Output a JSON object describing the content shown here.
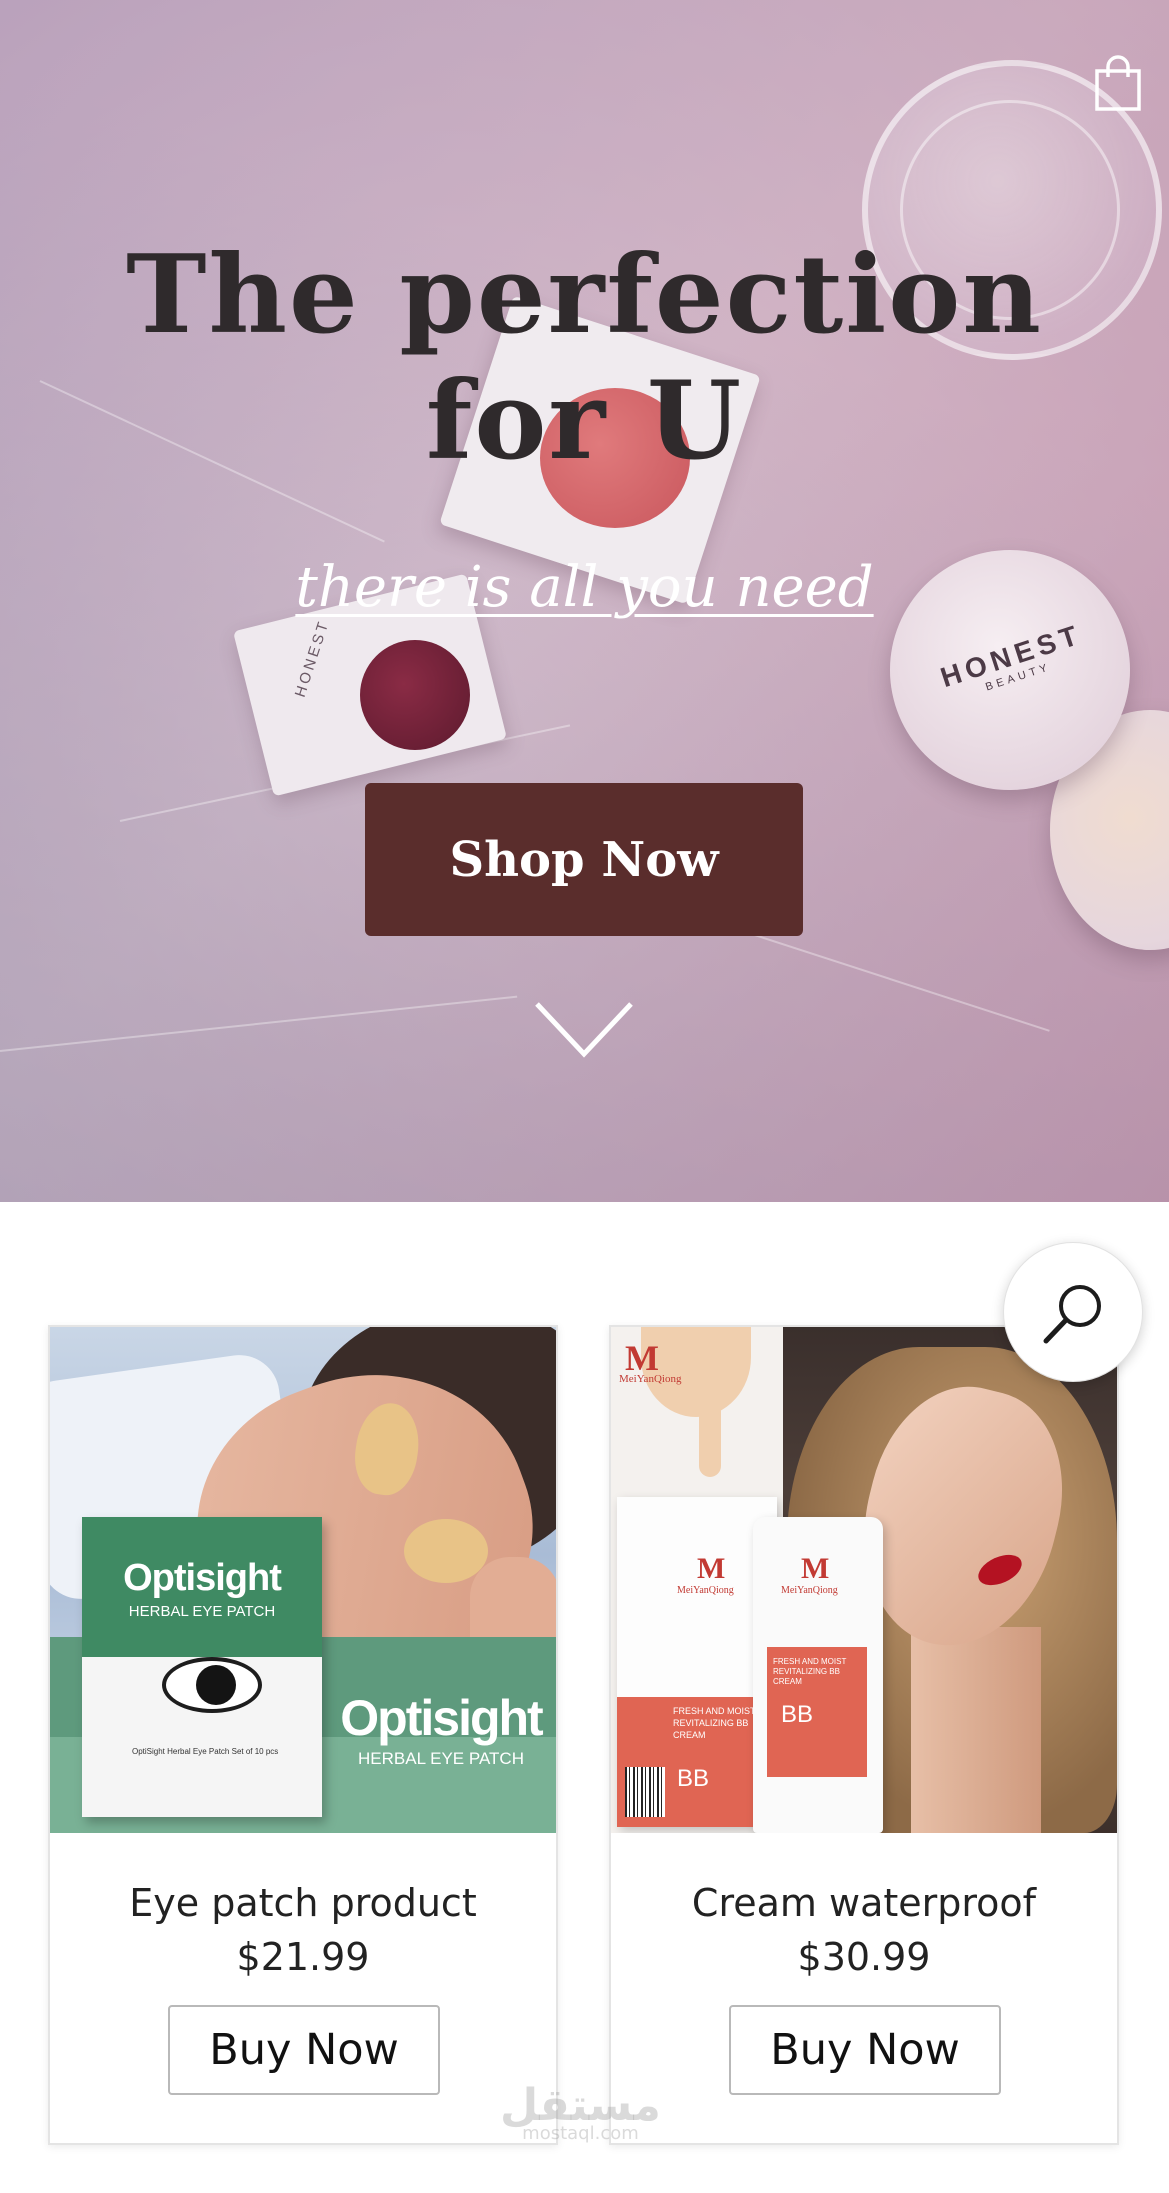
{
  "hero": {
    "title_line1": "The perfection",
    "title_line2": "for U",
    "subtitle": "there is all  you need",
    "cta_label": "Shop Now",
    "cart_icon": "shopping-bag-icon",
    "scroll_icon": "chevron-down-icon",
    "product_branding": {
      "jar_brand": "HONEST",
      "jar_sub": "BEAUTY",
      "compact_brand": "HONEST"
    }
  },
  "search": {
    "icon": "search-icon"
  },
  "products": [
    {
      "name": "Eye patch product",
      "price": "$21.99",
      "button": "Buy Now",
      "image_text": {
        "box_title": "Optisight",
        "box_subtitle": "HERBAL EYE PATCH",
        "box_small": "OptiSight Herbal Eye Patch Set of 10 pcs",
        "big_title": "Optisight",
        "big_subtitle": "HERBAL EYE PATCH"
      }
    },
    {
      "name": "Cream waterproof",
      "price": "$30.99",
      "button": "Buy Now",
      "image_text": {
        "brand": "MeiYanQiong",
        "logo": "M",
        "box_text": "FRESH AND MOIST REVITALIZING BB CREAM",
        "box_bb": "BB",
        "tube_text": "FRESH AND MOIST REVITALIZING BB CREAM",
        "tube_bb": "BB"
      }
    }
  ],
  "watermark": {
    "arabic": "مستقل",
    "latin": "mostaql.com"
  },
  "colors": {
    "cta_bg": "#5a2d2c",
    "text_dark": "#2f2a2c",
    "card_border": "#e4e4e4"
  }
}
